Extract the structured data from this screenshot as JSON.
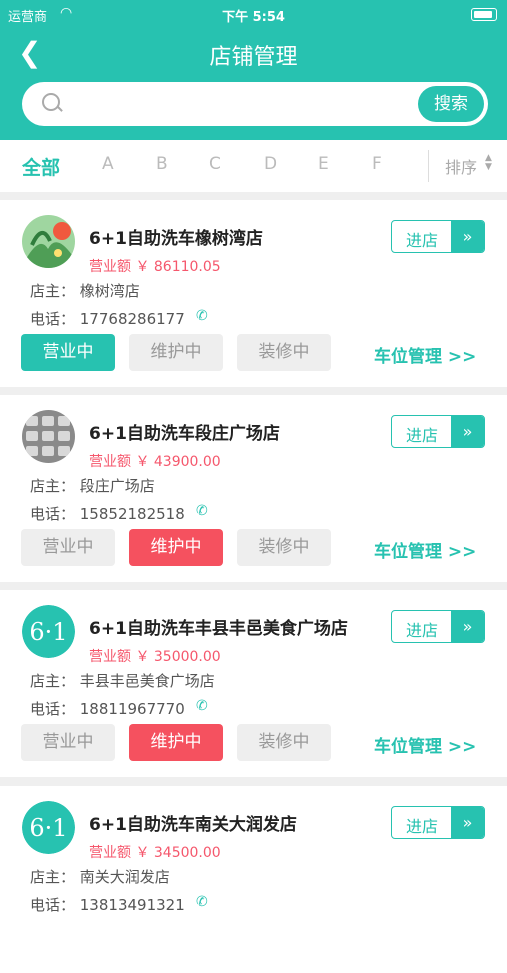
{
  "status_bar": {
    "carrier": "运营商",
    "time": "下午 5:54"
  },
  "nav": {
    "title": "店铺管理"
  },
  "search": {
    "placeholder": "",
    "button_label": "搜索"
  },
  "filter": {
    "tabs": [
      "全部",
      "A",
      "B",
      "C",
      "D",
      "E",
      "F"
    ],
    "sort_label": "排序"
  },
  "stores": [
    {
      "name": "6+1自助洗车橡树湾店",
      "revenue": "营业额 ￥ 86110.05",
      "owner": "店主：  橡树湾店",
      "phone": "电话：  17768286177",
      "enter_label": "进店",
      "status_labels": [
        "营业中",
        "维护中",
        "装修中"
      ],
      "active_status": "营业中",
      "parking_label": "车位管理 >>"
    },
    {
      "name": "6+1自助洗车段庄广场店",
      "revenue": "营业额 ￥ 43900.00",
      "owner": "店主：  段庄广场店",
      "phone": "电话：  15852182518",
      "enter_label": "进店",
      "status_labels": [
        "营业中",
        "维护中",
        "装修中"
      ],
      "active_status": "维护中",
      "parking_label": "车位管理 >>"
    },
    {
      "name": "6+1自助洗车丰县丰邑美食广场店",
      "revenue": "营业额 ￥ 35000.00",
      "owner": "店主：  丰县丰邑美食广场店",
      "phone": "电话：  18811967770",
      "enter_label": "进店",
      "status_labels": [
        "营业中",
        "维护中",
        "装修中"
      ],
      "active_status": "维护中",
      "parking_label": "车位管理 >>"
    },
    {
      "name": "6+1自助洗车南关大润发店",
      "revenue": "营业额 ￥ 34500.00",
      "owner": "店主：  南关大润发店",
      "phone": "电话：  13813491321",
      "enter_label": "进店"
    }
  ],
  "logo_text": "6·1",
  "colors": {
    "accent": "#27c2b0",
    "danger": "#f5515f",
    "revenue": "#f5576c"
  }
}
